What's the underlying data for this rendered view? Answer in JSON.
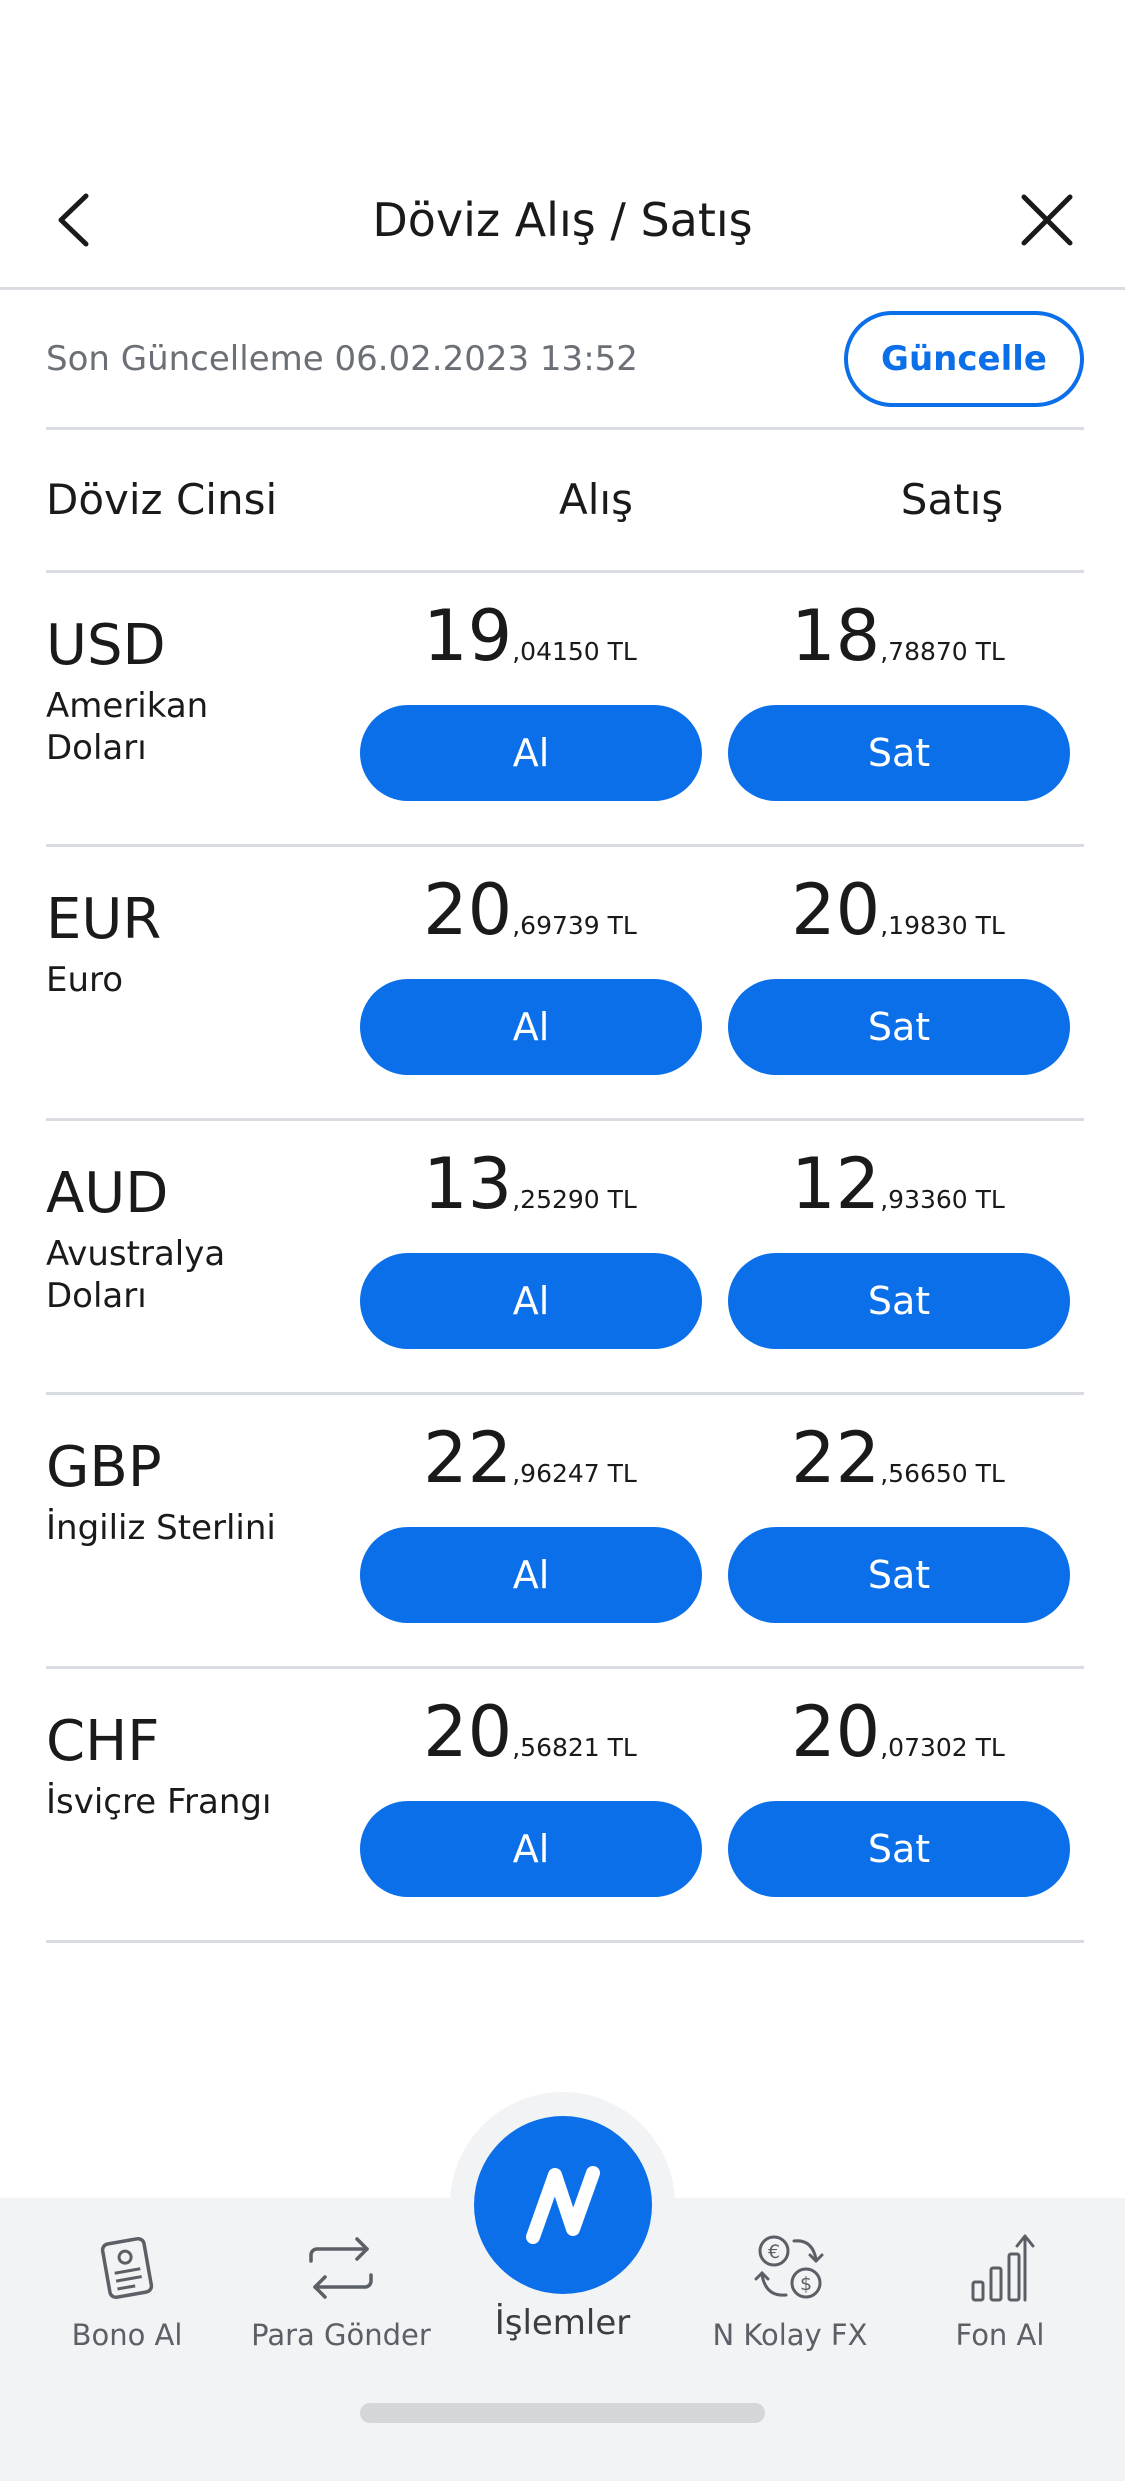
{
  "header": {
    "title": "Döviz Alış / Satış"
  },
  "update": {
    "text": "Son Güncelleme 06.02.2023 13:52",
    "button_label": "Güncelle"
  },
  "columns": {
    "type": "Döviz Cinsi",
    "buy": "Alış",
    "sell": "Satış"
  },
  "rates": [
    {
      "code": "USD",
      "name": "Amerikan Doları",
      "buy_int": "19",
      "buy_dec": ",04150 TL",
      "sell_int": "18",
      "sell_dec": ",78870 TL",
      "buy_label": "Al",
      "sell_label": "Sat"
    },
    {
      "code": "EUR",
      "name": "Euro",
      "buy_int": "20",
      "buy_dec": ",69739 TL",
      "sell_int": "20",
      "sell_dec": ",19830 TL",
      "buy_label": "Al",
      "sell_label": "Sat"
    },
    {
      "code": "AUD",
      "name": "Avustralya Doları",
      "buy_int": "13",
      "buy_dec": ",25290 TL",
      "sell_int": "12",
      "sell_dec": ",93360 TL",
      "buy_label": "Al",
      "sell_label": "Sat"
    },
    {
      "code": "GBP",
      "name": "İngiliz Sterlini",
      "buy_int": "22",
      "buy_dec": ",96247 TL",
      "sell_int": "22",
      "sell_dec": ",56650 TL",
      "buy_label": "Al",
      "sell_label": "Sat"
    },
    {
      "code": "CHF",
      "name": "İsviçre Frangı",
      "buy_int": "20",
      "buy_dec": ",56821 TL",
      "sell_int": "20",
      "sell_dec": ",07302 TL",
      "buy_label": "Al",
      "sell_label": "Sat"
    }
  ],
  "nav": {
    "items": [
      {
        "label": "Bono Al",
        "icon": "bond-document-icon"
      },
      {
        "label": "Para Gönder",
        "icon": "transfer-arrows-icon"
      },
      {
        "label": "İşlemler",
        "icon": "n-logo-icon"
      },
      {
        "label": "N Kolay FX",
        "icon": "currency-exchange-icon"
      },
      {
        "label": "Fon Al",
        "icon": "fund-chart-icon"
      }
    ]
  },
  "colors": {
    "accent": "#0a6fe8",
    "divider": "#d9dce2",
    "nav_bg": "#f2f3f5"
  }
}
